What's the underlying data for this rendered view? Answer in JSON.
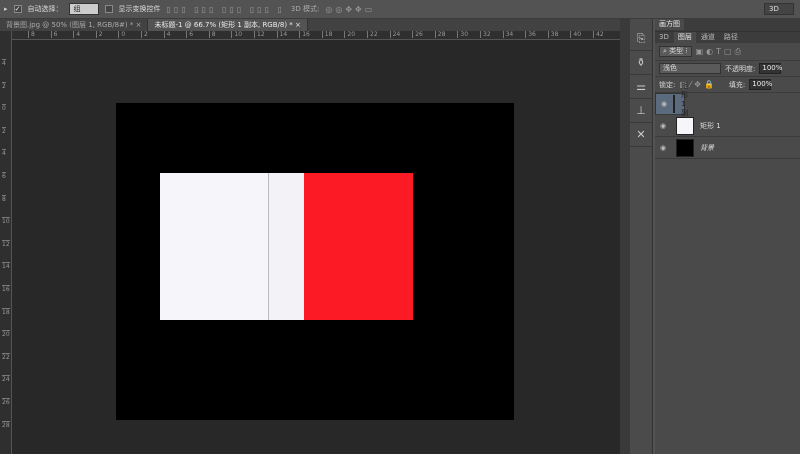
{
  "options_bar": {
    "auto_select_label": "自动选择：",
    "auto_select_value": "组",
    "show_transform_label": "显示变换控件",
    "mode_3d_label": "3D 模式:",
    "workspace": "3D"
  },
  "tabs": [
    {
      "label": "背景图.jpg @ 50% (图层 1, RGB/8#) *",
      "active": false
    },
    {
      "label": "未标题-1 @ 66.7% (矩形 1 副本, RGB/8) *",
      "active": true
    }
  ],
  "hruler": [
    "8",
    "6",
    "4",
    "2",
    "0",
    "2",
    "4",
    "6",
    "8",
    "10",
    "12",
    "14",
    "16",
    "18",
    "20",
    "22",
    "24",
    "26",
    "28",
    "30",
    "32",
    "34",
    "36",
    "38",
    "40",
    "42"
  ],
  "vruler": [
    "4",
    "2",
    "0",
    "2",
    "4",
    "6",
    "8",
    "10",
    "12",
    "14",
    "16",
    "18",
    "20",
    "22",
    "24",
    "26",
    "28"
  ],
  "document": {
    "background": "#000000",
    "shapes": [
      {
        "color": "#f6f5fa"
      },
      {
        "color": "#f3f2f7"
      },
      {
        "color": "#fc1b24"
      }
    ]
  },
  "panel": {
    "title": "画方图",
    "tabs": [
      "3D",
      "图层",
      "通道",
      "路径"
    ],
    "active_tab": "图层",
    "filter_label": "类型",
    "blend_mode": "浅色",
    "opacity_label": "不透明度:",
    "opacity": "100%",
    "lock_label": "锁定:",
    "fill_label": "填充:",
    "fill": "100%",
    "layers": [
      {
        "name": "矩形 1 副本",
        "thumb": "#fc1b24",
        "selected": true
      },
      {
        "name": "矩形 1",
        "thumb": "#f6f5fa",
        "selected": false
      },
      {
        "name": "背景",
        "thumb": "#000000",
        "selected": false
      }
    ]
  }
}
